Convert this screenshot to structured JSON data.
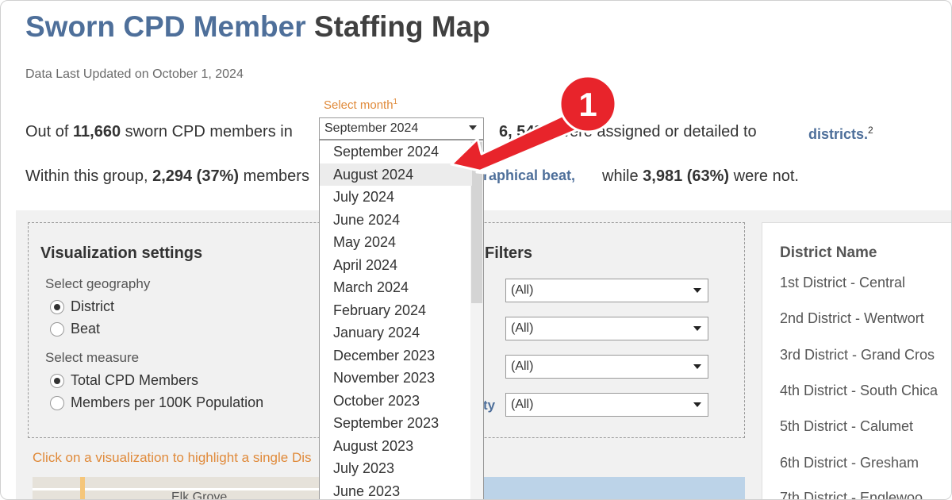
{
  "header": {
    "title_part1": "Sworn CPD Member",
    "title_part2": "Staffing Map",
    "updated": "Data Last Updated on October 1, 2024"
  },
  "month_select": {
    "label": "Select month",
    "label_sup": "1",
    "value": "September 2024",
    "options": [
      "September 2024",
      "August 2024",
      "July 2024",
      "June 2024",
      "May 2024",
      "April 2024",
      "March 2024",
      "February 2024",
      "January 2024",
      "December 2023",
      "November 2023",
      "October 2023",
      "September 2023",
      "August 2023",
      "July 2023",
      "June 2023"
    ],
    "highlighted_index": 1
  },
  "summary": {
    "line1_prefix": "Out of ",
    "line1_total": "11,660",
    "line1_mid": " sworn CPD members in",
    "line1_partial_count": "6,",
    "line1_partial_pct": "54%)",
    "line1_suffix": " were assigned or detailed to",
    "districts_link": "districts.",
    "districts_sup": "2",
    "line2_prefix": "Within this group, ",
    "line2_count": "2,294 (37%)",
    "line2_mid": " members",
    "beat_link": "raphical beat,",
    "line2_after_prefix": "while ",
    "line2_after_count": "3,981 (63%)",
    "line2_after_suffix": " were not."
  },
  "settings": {
    "title": "Visualization settings",
    "geography_label": "Select geography",
    "geography_options": [
      "District",
      "Beat"
    ],
    "geography_selected": "District",
    "measure_label": "Select measure",
    "measure_options": [
      "Total CPD Members",
      "Members per 100K Population"
    ],
    "measure_selected": "Total CPD Members"
  },
  "filters": {
    "title": "Filters",
    "values": [
      "(All)",
      "(All)",
      "(All)",
      "(All)"
    ],
    "partial_label": "ty"
  },
  "hint": "Click on a visualization to highlight a single Dis",
  "map": {
    "city_label": "Elk Grove"
  },
  "district_panel": {
    "header": "District Name",
    "items": [
      "1st District - Central",
      "2nd District - Wentwort",
      "3rd District - Grand Cros",
      "4th District - South Chica",
      "5th District - Calumet",
      "6th District - Gresham",
      "7th District - Englewoo"
    ]
  },
  "annotation": {
    "number": "1",
    "color": "#e8242b"
  }
}
